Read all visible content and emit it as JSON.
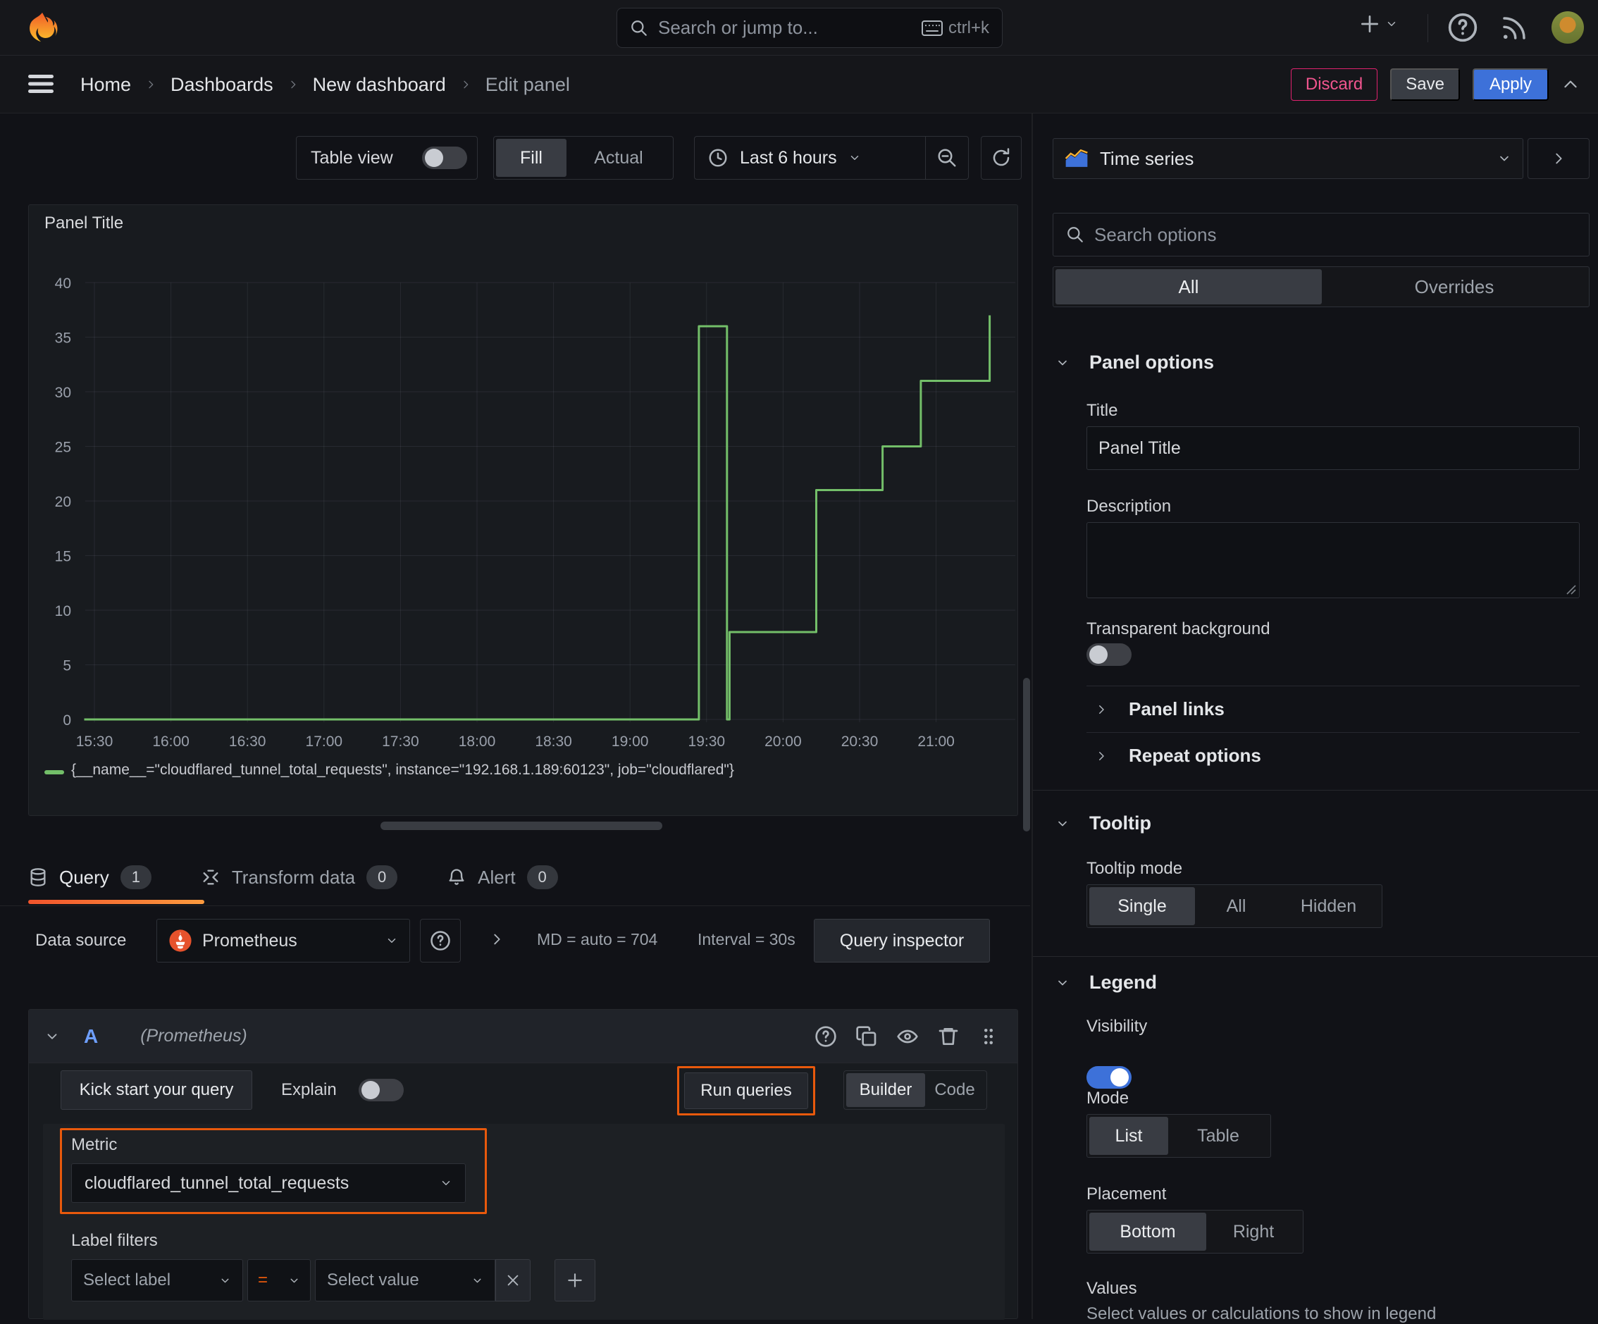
{
  "colors": {
    "accent_orange": "#e8590c",
    "series_green": "#73bf69",
    "primary_blue": "#3d71d9",
    "discard_pink": "#e0226e"
  },
  "topbar": {
    "search_placeholder": "Search or jump to...",
    "shortcut": "ctrl+k"
  },
  "breadcrumb": {
    "items": [
      "Home",
      "Dashboards",
      "New dashboard",
      "Edit panel"
    ]
  },
  "actions": {
    "discard": "Discard",
    "save": "Save",
    "apply": "Apply"
  },
  "toolbar": {
    "table_view": "Table view",
    "fill": "Fill",
    "actual": "Actual",
    "time_range": "Last 6 hours"
  },
  "panel": {
    "title": "Panel Title"
  },
  "chart_data": {
    "type": "line",
    "stepped": true,
    "title": "Panel Title",
    "x_ticks": [
      "15:30",
      "16:00",
      "16:30",
      "17:00",
      "17:30",
      "18:00",
      "18:30",
      "19:00",
      "19:30",
      "20:00",
      "20:30",
      "21:00"
    ],
    "y_ticks": [
      0,
      5,
      10,
      15,
      20,
      25,
      30,
      35,
      40
    ],
    "ylim": [
      0,
      40
    ],
    "grid": true,
    "legend_position": "bottom",
    "series": [
      {
        "name": "{__name__=\"cloudflared_tunnel_total_requests\", instance=\"192.168.1.189:60123\", job=\"cloudflared\"}",
        "color": "#73bf69",
        "points": [
          [
            "15:26",
            0
          ],
          [
            "19:27",
            0
          ],
          [
            "19:27",
            36
          ],
          [
            "19:38",
            36
          ],
          [
            "19:38",
            0
          ],
          [
            "19:39",
            0
          ],
          [
            "19:39",
            8
          ],
          [
            "20:13",
            8
          ],
          [
            "20:13",
            21
          ],
          [
            "20:39",
            21
          ],
          [
            "20:39",
            25
          ],
          [
            "20:54",
            25
          ],
          [
            "20:54",
            31
          ],
          [
            "21:21",
            31
          ],
          [
            "21:21",
            37
          ]
        ]
      }
    ]
  },
  "tabs": [
    {
      "label": "Query",
      "count": "1"
    },
    {
      "label": "Transform data",
      "count": "0"
    },
    {
      "label": "Alert",
      "count": "0"
    }
  ],
  "datasource": {
    "label": "Data source",
    "value": "Prometheus",
    "stats_md": "MD = auto = 704",
    "stats_interval": "Interval = 30s",
    "inspector": "Query inspector"
  },
  "query": {
    "ref": "A",
    "ds": "(Prometheus)",
    "kickstart": "Kick start your query",
    "explain": "Explain",
    "run": "Run queries",
    "builder": "Builder",
    "code": "Code",
    "metric_label": "Metric",
    "metric_value": "cloudflared_tunnel_total_requests",
    "filters_label": "Label filters",
    "select_label": "Select label",
    "operator": "=",
    "select_value": "Select value"
  },
  "options": {
    "viz": "Time series",
    "search_placeholder": "Search options",
    "tab_all": "All",
    "tab_overrides": "Overrides",
    "panel_options": {
      "title": "Panel options",
      "title_label": "Title",
      "title_value": "Panel Title",
      "desc_label": "Description",
      "transparent": "Transparent background",
      "links": "Panel links",
      "repeat": "Repeat options"
    },
    "tooltip": {
      "title": "Tooltip",
      "mode_label": "Tooltip mode",
      "modes": [
        "Single",
        "All",
        "Hidden"
      ]
    },
    "legend": {
      "title": "Legend",
      "visibility": "Visibility",
      "mode_label": "Mode",
      "modes": [
        "List",
        "Table"
      ],
      "placement_label": "Placement",
      "placements": [
        "Bottom",
        "Right"
      ],
      "values_label": "Values",
      "values_hint": "Select values or calculations to show in legend"
    }
  }
}
